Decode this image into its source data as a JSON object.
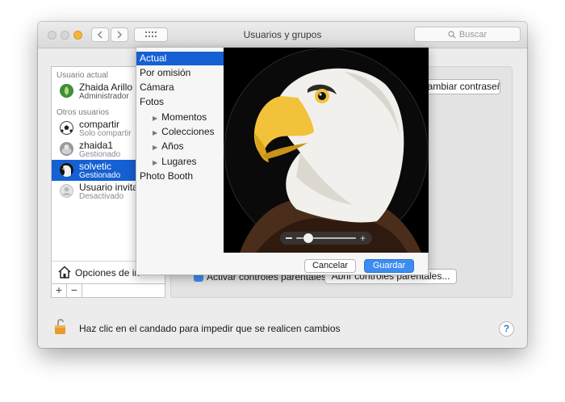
{
  "window": {
    "title": "Usuarios y grupos"
  },
  "search": {
    "placeholder": "Buscar"
  },
  "users_panel": {
    "current_header": "Usuario actual",
    "current_user": {
      "name": "Zhaida Arillo",
      "role": "Administrador"
    },
    "others_header": "Otros usuarios",
    "others": [
      {
        "name": "compartir",
        "role": "Solo compartir"
      },
      {
        "name": "zhaida1",
        "role": "Gestionado"
      },
      {
        "name": "solvetic",
        "role": "Gestionado"
      },
      {
        "name": "Usuario invitado",
        "role": "Desactivado"
      }
    ],
    "login_options": "Opciones de in",
    "add_label": "+",
    "remove_label": "−"
  },
  "background_controls": {
    "change_password_label": "Cambiar contraseña...",
    "parental_checkbox_label": "Activar controles parentales",
    "parental_button_label": "Abrir controles parentales..."
  },
  "picture_picker": {
    "sources": [
      {
        "label": "Actual",
        "selected": true
      },
      {
        "label": "Por omisión"
      },
      {
        "label": "Cámara"
      },
      {
        "label": "Fotos"
      },
      {
        "label": "Momentos",
        "child": true
      },
      {
        "label": "Colecciones",
        "child": true
      },
      {
        "label": "Años",
        "child": true
      },
      {
        "label": "Lugares",
        "child": true
      },
      {
        "label": "Photo Booth"
      }
    ],
    "zoom_level": 0.12,
    "cancel_label": "Cancelar",
    "save_label": "Guardar"
  },
  "footer": {
    "lock_message": "Haz clic en el candado para impedir que se realicen cambios",
    "help_label": "?"
  },
  "colors": {
    "selection": "#1560d3",
    "primary_button": "#3d8cf0",
    "lock": "#e89a2e"
  }
}
